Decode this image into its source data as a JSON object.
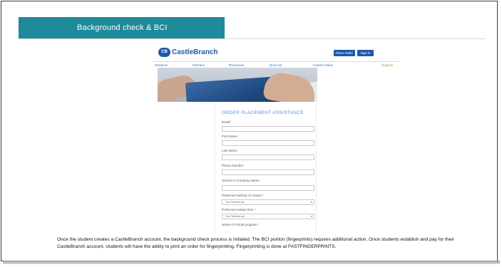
{
  "slide": {
    "title": "Background check & BCI",
    "caption_line1": "Once the student creates a CastleBranch account, the background check process is initiated.  The BCI portion (fingerprints) requires additional action.  Once students establish and pay for their",
    "caption_line2": "CastleBranch account, students will have the ability to print an order for fingerprinting.  Fingerprinting is done at FASTFINGERPRINTS."
  },
  "site": {
    "logo_mark": "CB",
    "logo_text": "CastleBranch",
    "buttons": {
      "place_order": "Place Order",
      "sign_in": "Sign In"
    },
    "nav": [
      "Solutions",
      "Partners",
      "Resources",
      "About Us",
      "Contact Sales",
      "Support"
    ],
    "form": {
      "heading": "ORDER PLACEMENT ASSISTANCE",
      "email_label": "Email",
      "first_name_label": "First Name",
      "last_name_label": "Last Name",
      "phone_label": "Phone Number",
      "school_label": "School or Company Name",
      "contact_method_label": "Preferred method of contact",
      "contact_method_value": "No Preference",
      "contact_time_label": "Preferred contact time",
      "contact_time_value": "No Preference",
      "program_label": "Name of school program",
      "required_mark": "*"
    }
  },
  "colors": {
    "title_bar": "#1f8a99",
    "brand_blue": "#1d5aa6",
    "support_green": "#6fae2c"
  }
}
